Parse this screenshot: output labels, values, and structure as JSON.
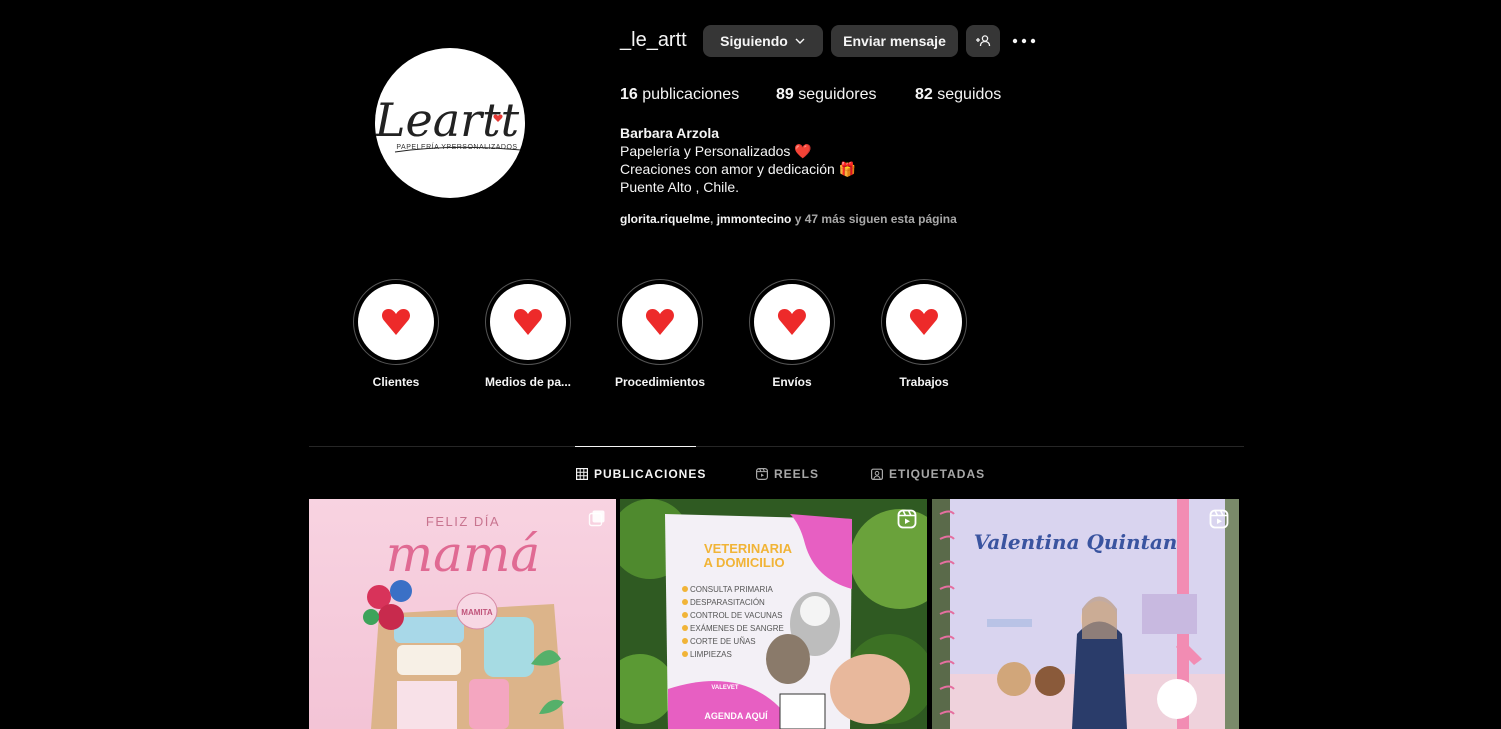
{
  "profile": {
    "username": "_le_artt",
    "follow_button": "Siguiendo",
    "message_button": "Enviar mensaje",
    "stats": {
      "posts_count": "16",
      "posts_label": "publicaciones",
      "followers_count": "89",
      "followers_label": "seguidores",
      "following_count": "82",
      "following_label": "seguidos"
    },
    "bio": {
      "name": "Barbara Arzola",
      "line1": "Papelería y Personalizados ❤️",
      "line2": "Creaciones con amor y dedicación 🎁",
      "line3": "Puente Alto , Chile."
    },
    "followed_by": {
      "user1": "glorita.riquelme",
      "sep": ", ",
      "user2": "jmmontecino",
      "rest": " y 47 más siguen esta página"
    },
    "avatar_logo": {
      "script": "Leartt",
      "tagline": "PAPELERÍA YPERSONALIZADOS"
    }
  },
  "highlights": [
    {
      "label": "Clientes",
      "icon": "heart-icon"
    },
    {
      "label": "Medios de pa...",
      "icon": "heart-icon"
    },
    {
      "label": "Procedimientos",
      "icon": "heart-icon"
    },
    {
      "label": "Envíos",
      "icon": "heart-icon"
    },
    {
      "label": "Trabajos",
      "icon": "heart-icon"
    }
  ],
  "tabs": [
    {
      "label": "PUBLICACIONES",
      "icon": "grid-icon",
      "active": true
    },
    {
      "label": "REELS",
      "icon": "reels-icon",
      "active": false
    },
    {
      "label": "ETIQUETADAS",
      "icon": "tagged-icon",
      "active": false
    }
  ],
  "posts": [
    {
      "type": "carousel",
      "heading_small": "FELIZ DÍA",
      "heading_big": "mamá",
      "tag": "MAMITA"
    },
    {
      "type": "reel",
      "title1": "VETERINARIA",
      "title2": "A DOMICILIO",
      "items": [
        "CONSULTA PRIMARIA",
        "DESPARASITACIÓN",
        "CONTROL DE VACUNAS",
        "EXÁMENES DE SANGRE",
        "CORTE DE UÑAS",
        "LIMPIEZAS"
      ],
      "brand": "VALEVET",
      "footer": "AGENDA AQUÍ"
    },
    {
      "type": "reel",
      "title": "Valentina Quintana"
    }
  ],
  "colors": {
    "background": "#000000",
    "button": "#363636",
    "heart": "#ed2a2a",
    "muted_text": "#a8a8a8"
  }
}
